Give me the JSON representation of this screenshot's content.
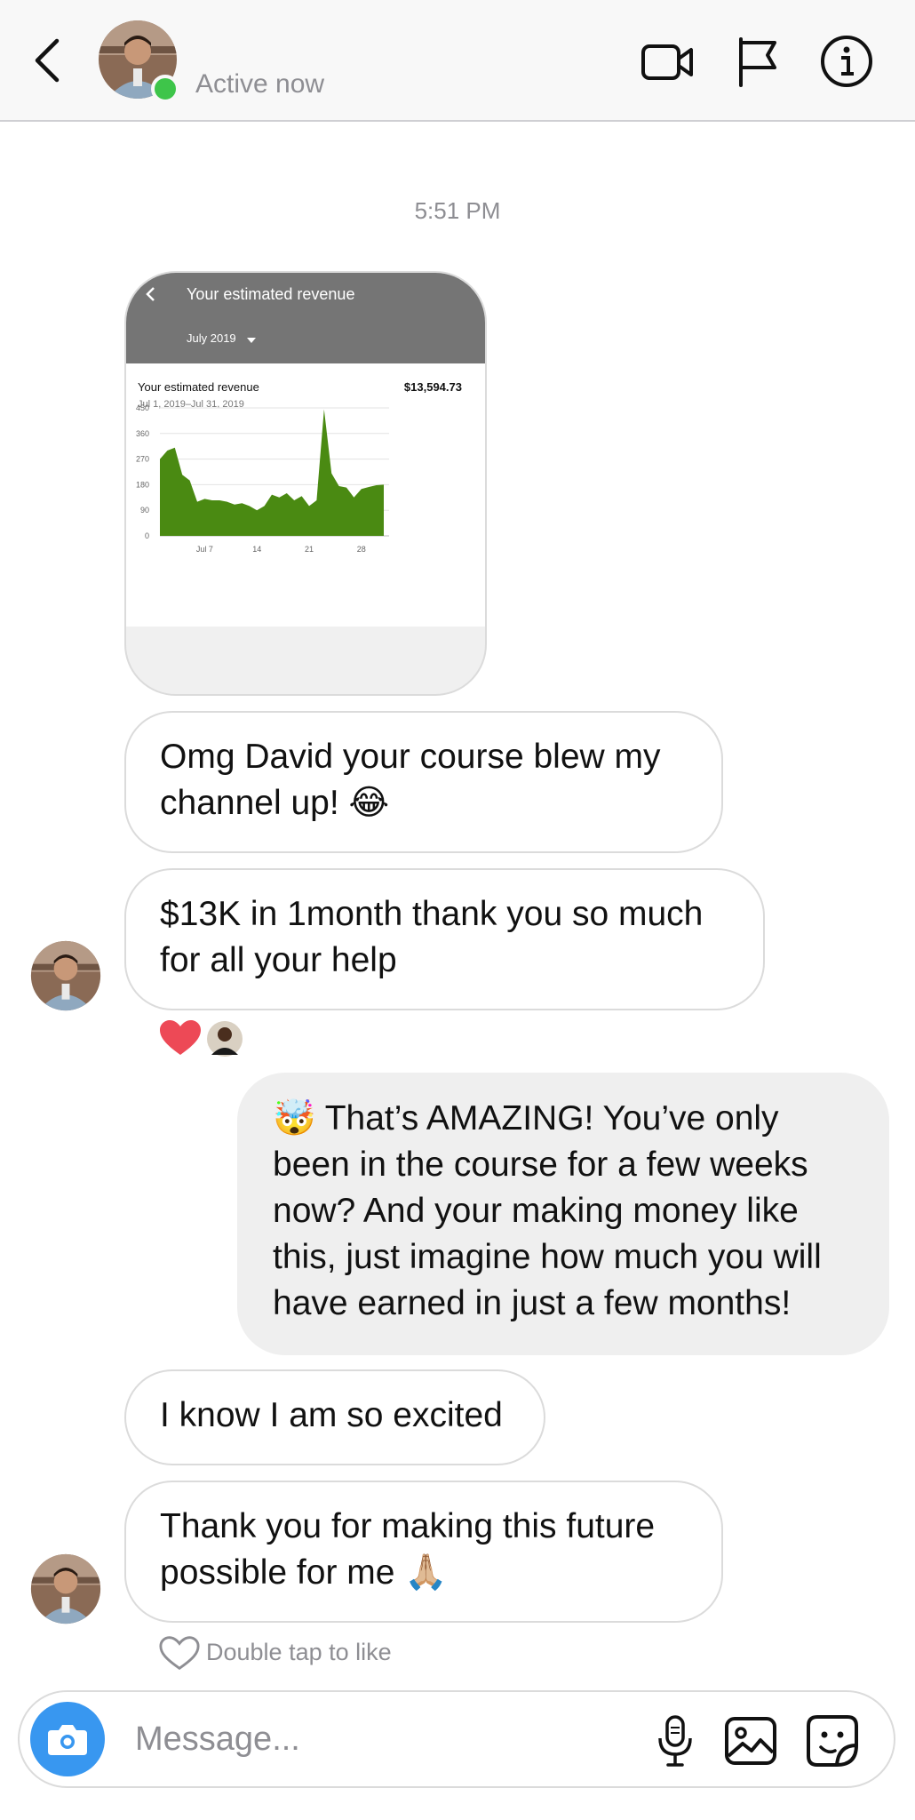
{
  "header": {
    "status": "Active now",
    "back_icon": "chevron-left-icon",
    "video_icon": "video-camera-icon",
    "report_icon": "flag-icon",
    "info_icon": "info-icon"
  },
  "conversation": {
    "timestamp": "5:51 PM",
    "shared_image": {
      "title": "Your estimated revenue",
      "month_selector": "July 2019",
      "metric_label": "Your estimated revenue",
      "date_range": "Jul 1, 2019–Jul 31, 2019",
      "total": "$13,594.73",
      "chart_color": "#4a8a12"
    },
    "messages": [
      {
        "id": "m1",
        "sender": "them",
        "text": "Omg David your course blew my channel up! 😂"
      },
      {
        "id": "m2",
        "sender": "them",
        "text": "$13K in 1month thank you so much for all your help"
      },
      {
        "id": "m3",
        "sender": "me",
        "text": "🤯 That’s AMAZING! You’ve only been in the course for a few weeks now? And your making money like this, just imagine how much you will have earned in just a few months!"
      },
      {
        "id": "m4",
        "sender": "them",
        "text": "I know I am so excited"
      },
      {
        "id": "m5",
        "sender": "them",
        "text": "Thank you for making this future possible for me 🙏🏼"
      }
    ],
    "reactions": [
      "heart",
      "avatar"
    ],
    "like_hint": "Double tap to like"
  },
  "composer": {
    "placeholder": "Message...",
    "camera_icon": "camera-icon",
    "mic_icon": "microphone-icon",
    "gallery_icon": "image-icon",
    "sticker_icon": "sticker-icon"
  },
  "chart_data": {
    "type": "area",
    "title": "Your estimated revenue",
    "subtitle": "Jul 1, 2019–Jul 31, 2019",
    "ylim": [
      0,
      450
    ],
    "yticks": [
      0,
      90,
      180,
      270,
      360,
      450
    ],
    "xticks": [
      {
        "day": 7,
        "label": "Jul 7"
      },
      {
        "day": 14,
        "label": "14"
      },
      {
        "day": 21,
        "label": "21"
      },
      {
        "day": 28,
        "label": "28"
      }
    ],
    "x": [
      1,
      2,
      3,
      4,
      5,
      6,
      7,
      8,
      9,
      10,
      11,
      12,
      13,
      14,
      15,
      16,
      17,
      18,
      19,
      20,
      21,
      22,
      23,
      24,
      25,
      26,
      27,
      28,
      29,
      30,
      31
    ],
    "values": [
      270,
      300,
      310,
      215,
      195,
      120,
      130,
      125,
      125,
      120,
      110,
      115,
      105,
      90,
      105,
      145,
      135,
      150,
      125,
      140,
      105,
      125,
      445,
      220,
      175,
      170,
      135,
      165,
      172,
      178,
      180
    ],
    "color": "#4a8a12"
  }
}
